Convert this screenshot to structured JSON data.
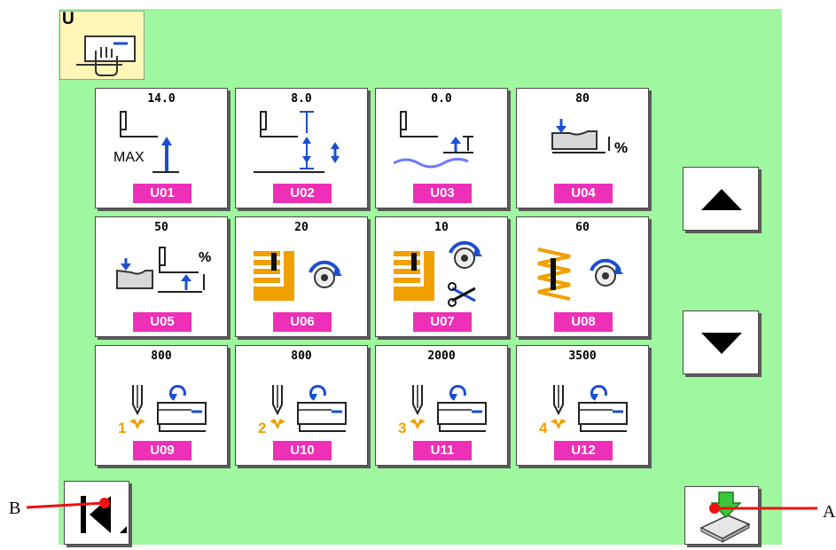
{
  "mode": {
    "letter": "U",
    "icon": "hand-pressing-panel-icon"
  },
  "tiles": [
    {
      "value": "14.0",
      "code": "U01",
      "icon": "max-presser-lift-icon"
    },
    {
      "value": "8.0",
      "code": "U02",
      "icon": "presser-height-icon"
    },
    {
      "value": "0.0",
      "code": "U03",
      "icon": "presser-lowest-icon"
    },
    {
      "value": "80",
      "code": "U04",
      "icon": "presser-pressure-percent-icon"
    },
    {
      "value": "50",
      "code": "U05",
      "icon": "pressure-height-percent-icon"
    },
    {
      "value": "20",
      "code": "U06",
      "icon": "bartack-speed-dial-icon"
    },
    {
      "value": "10",
      "code": "U07",
      "icon": "bartack-trim-speed-icon"
    },
    {
      "value": "60",
      "code": "U08",
      "icon": "zigzag-speed-dial-icon"
    },
    {
      "value": "800",
      "code": "U09",
      "icon": "needle-1-speed-icon",
      "num": "1"
    },
    {
      "value": "800",
      "code": "U10",
      "icon": "needle-2-speed-icon",
      "num": "2"
    },
    {
      "value": "2000",
      "code": "U11",
      "icon": "needle-3-speed-icon",
      "num": "3"
    },
    {
      "value": "3500",
      "code": "U12",
      "icon": "needle-4-speed-icon",
      "num": "4"
    }
  ],
  "max_label": "MAX",
  "percent_sign": "%",
  "buttons": {
    "up": "up-arrow-icon",
    "down": "down-arrow-icon",
    "return": "return-icon",
    "data": "data-communication-icon"
  },
  "callouts": {
    "a": "A",
    "b": "B"
  },
  "colors": {
    "screen": "#9ff79f",
    "code_badge": "#ee2fb8",
    "accent_blue": "#1a4fd0",
    "orange": "#f0a000"
  }
}
